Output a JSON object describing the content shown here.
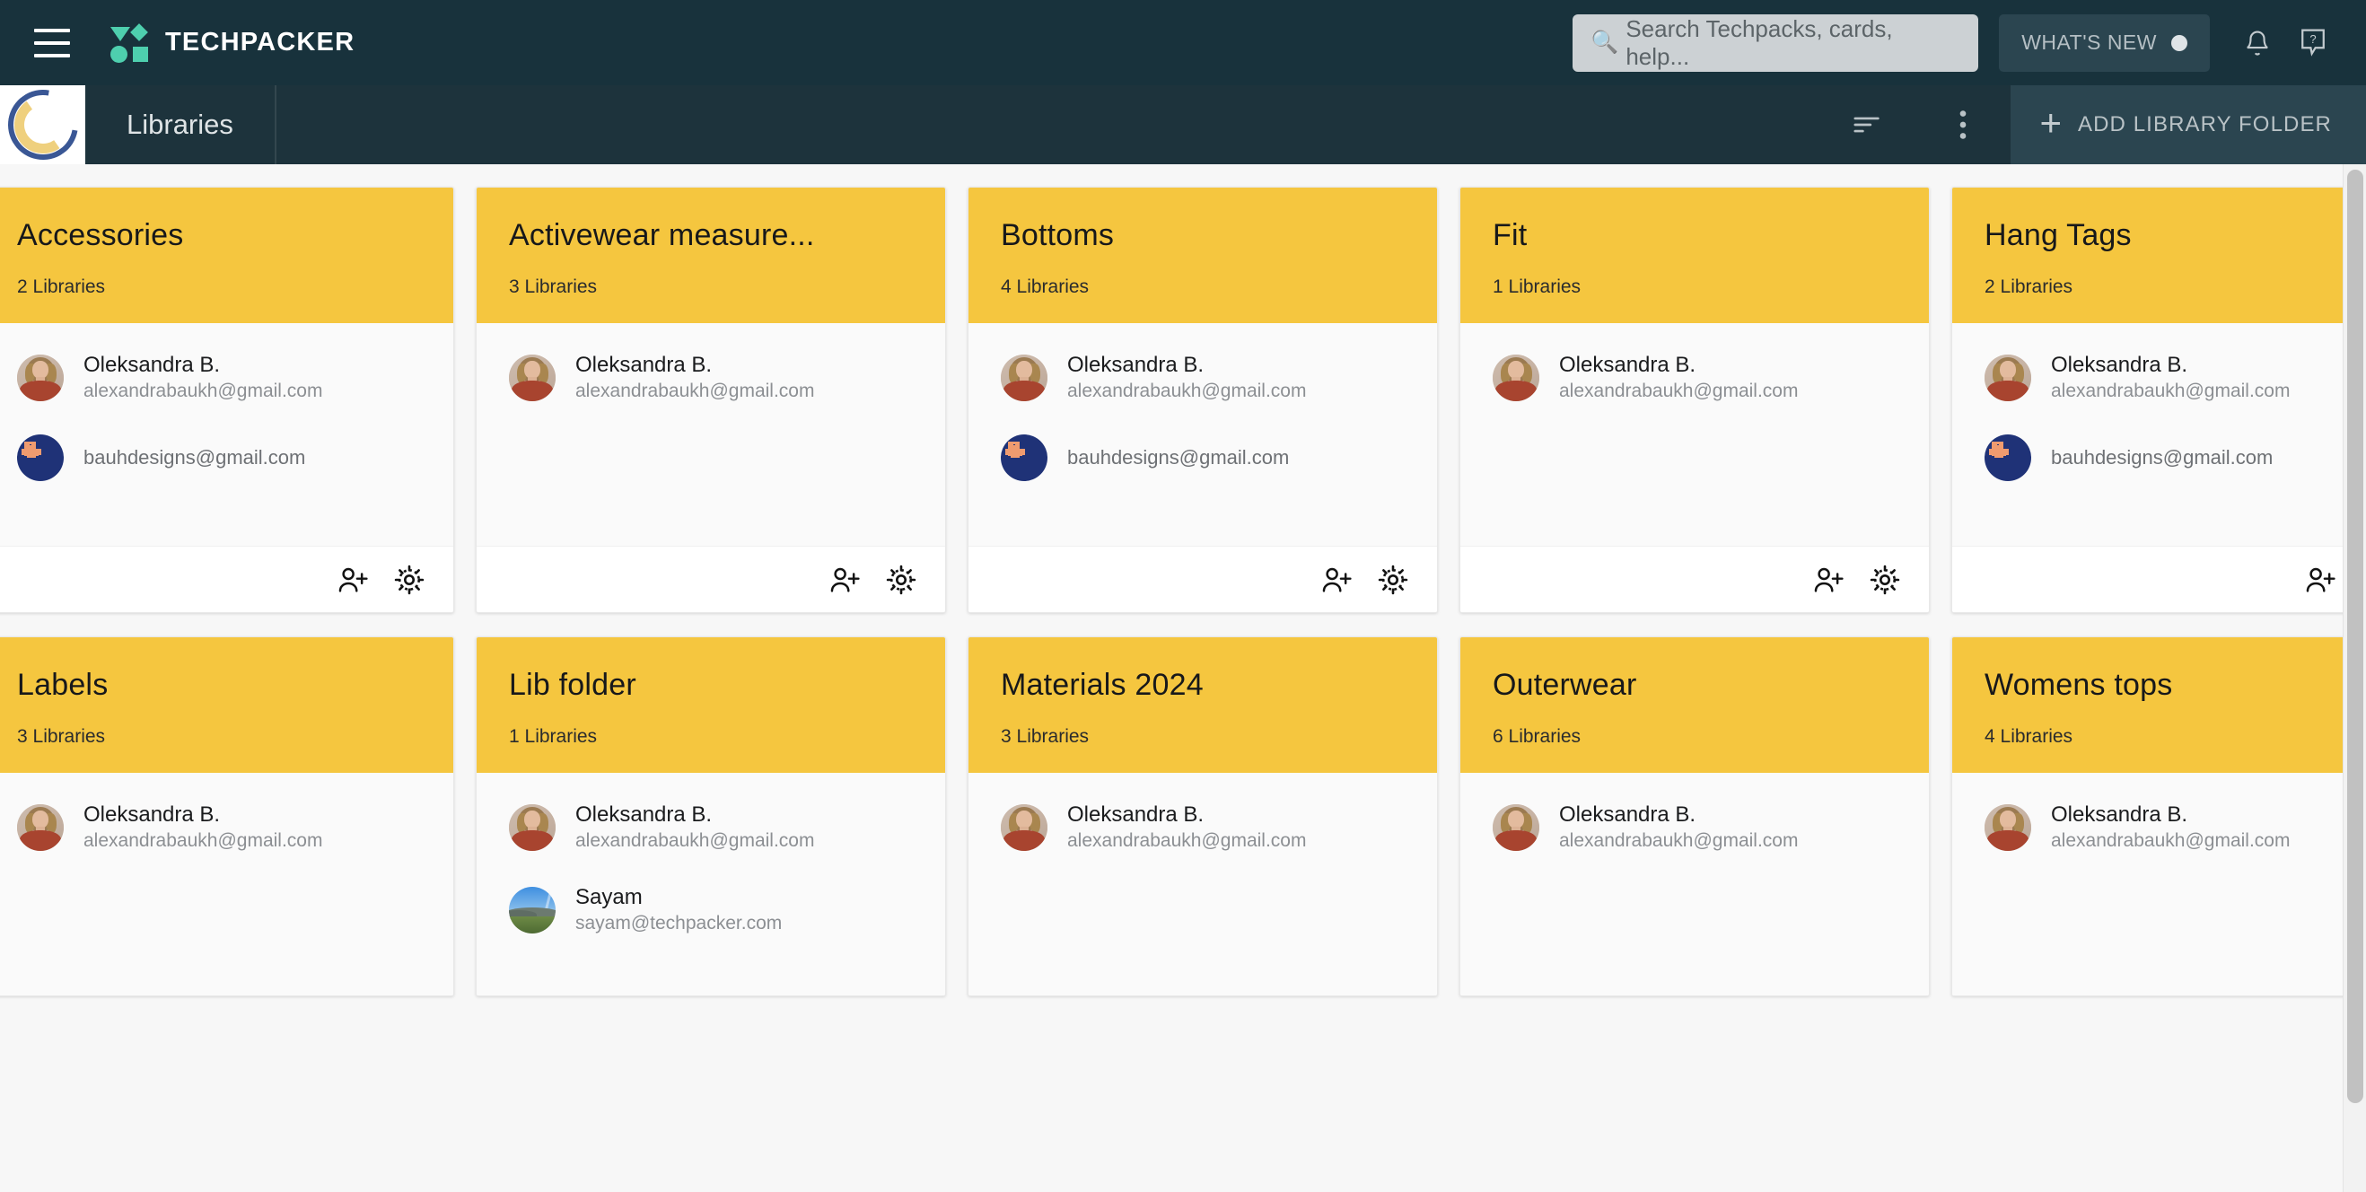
{
  "topbar": {
    "menu_icon": "hamburger-menu-icon",
    "brand": "TECHPACKER",
    "search": {
      "placeholder": "Search Techpacks, cards, help...",
      "value": "",
      "icon": "search-icon"
    },
    "whats_new": {
      "label": "WHAT'S NEW",
      "badge": "●"
    },
    "notifications_icon": "bell-icon",
    "help_icon": "help-question-icon"
  },
  "subheader": {
    "org_logo": "crescent-moon-logo",
    "title": "Libraries",
    "sort_icon": "sort-lines-icon",
    "more_icon": "more-vertical-icon",
    "add_button": {
      "label": "ADD LIBRARY FOLDER",
      "icon": "plus-icon"
    }
  },
  "colors": {
    "topbar_bg": "#18323c",
    "subbar_bg": "#1d333c",
    "card_header": "#f5c63f",
    "brand_accent": "#4ecfae",
    "page_bg": "#f7f7f7"
  },
  "footer_icons": {
    "add_member": "person-add-icon",
    "settings": "gear-icon"
  },
  "cards": [
    {
      "title": "Accessories",
      "count": "2 Libraries",
      "members": [
        {
          "avatar": "photo-woman",
          "name": "Oleksandra B.",
          "email": "alexandrabaukh@gmail.com"
        },
        {
          "avatar": "bauh-logo",
          "name": "",
          "email": "bauhdesigns@gmail.com"
        }
      ],
      "show_footer": true
    },
    {
      "title": "Activewear measure...",
      "count": "3 Libraries",
      "members": [
        {
          "avatar": "photo-woman",
          "name": "Oleksandra B.",
          "email": "alexandrabaukh@gmail.com"
        }
      ],
      "show_footer": true
    },
    {
      "title": "Bottoms",
      "count": "4 Libraries",
      "members": [
        {
          "avatar": "photo-woman",
          "name": "Oleksandra B.",
          "email": "alexandrabaukh@gmail.com"
        },
        {
          "avatar": "bauh-logo",
          "name": "",
          "email": "bauhdesigns@gmail.com"
        }
      ],
      "show_footer": true
    },
    {
      "title": "Fit",
      "count": "1 Libraries",
      "members": [
        {
          "avatar": "photo-woman",
          "name": "Oleksandra B.",
          "email": "alexandrabaukh@gmail.com"
        }
      ],
      "show_footer": true
    },
    {
      "title": "Hang Tags",
      "count": "2 Libraries",
      "members": [
        {
          "avatar": "photo-woman",
          "name": "Oleksandra B.",
          "email": "alexandrabaukh@gmail.com"
        },
        {
          "avatar": "bauh-logo",
          "name": "",
          "email": "bauhdesigns@gmail.com"
        }
      ],
      "show_footer": true
    },
    {
      "title": "Labels",
      "count": "3 Libraries",
      "members": [
        {
          "avatar": "photo-woman",
          "name": "Oleksandra B.",
          "email": "alexandrabaukh@gmail.com"
        }
      ],
      "show_footer": false
    },
    {
      "title": "Lib folder",
      "count": "1 Libraries",
      "members": [
        {
          "avatar": "photo-woman",
          "name": "Oleksandra B.",
          "email": "alexandrabaukh@gmail.com"
        },
        {
          "avatar": "landscape-photo",
          "name": "Sayam",
          "email": "sayam@techpacker.com"
        }
      ],
      "show_footer": false
    },
    {
      "title": "Materials 2024",
      "count": "3 Libraries",
      "members": [
        {
          "avatar": "photo-woman",
          "name": "Oleksandra B.",
          "email": "alexandrabaukh@gmail.com"
        }
      ],
      "show_footer": false
    },
    {
      "title": "Outerwear",
      "count": "6 Libraries",
      "members": [
        {
          "avatar": "photo-woman",
          "name": "Oleksandra B.",
          "email": "alexandrabaukh@gmail.com"
        }
      ],
      "show_footer": false
    },
    {
      "title": "Womens tops",
      "count": "4 Libraries",
      "members": [
        {
          "avatar": "photo-woman",
          "name": "Oleksandra B.",
          "email": "alexandrabaukh@gmail.com"
        }
      ],
      "show_footer": false
    }
  ]
}
